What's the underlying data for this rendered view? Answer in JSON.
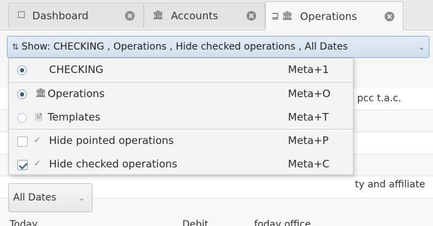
{
  "tabs": [
    {
      "label": "Dashboard",
      "icon": "dashboard-icon",
      "glyph": "☐",
      "closable": true,
      "active": false
    },
    {
      "label": "Accounts",
      "icon": "bank-icon",
      "glyph": "🏛",
      "closable": true,
      "active": false
    },
    {
      "label": "Operations",
      "icon": "operations-icon",
      "glyph": "⊒ 🏛",
      "closable": true,
      "active": true
    }
  ],
  "filter": {
    "icon_glyph": "⇅",
    "text": "Show: CHECKING , Operations , Hide checked operations , All Dates",
    "chevron": "⌄"
  },
  "menu": {
    "items": [
      {
        "type": "radio",
        "checked": true,
        "label": "CHECKING",
        "shortcut": "Meta+1"
      },
      {
        "type": "radio",
        "checked": true,
        "icon_glyph": "🏛",
        "label": "Operations",
        "shortcut": "Meta+O"
      },
      {
        "type": "radio",
        "checked": false,
        "icon_glyph": "🗎",
        "label": "Templates",
        "shortcut": "Meta+T"
      },
      {
        "type": "checkbox",
        "checked": false,
        "label": "Hide pointed operations",
        "shortcut": "Meta+P"
      },
      {
        "type": "checkbox",
        "checked": true,
        "label": "Hide checked operations",
        "shortcut": "Meta+C"
      }
    ],
    "check_glyph": "✓"
  },
  "background": {
    "row1_text": ": pcc t.a.c.",
    "row2_text": "ty and affiliate",
    "date_combo": "All Dates",
    "date_chevron": "⌄",
    "bottom_left": "Today",
    "bottom_mid": "Debit",
    "bottom_right": "foday office"
  },
  "colors": {
    "accent": "#2b5a8c",
    "filter_bg": "#d9e4f0"
  }
}
